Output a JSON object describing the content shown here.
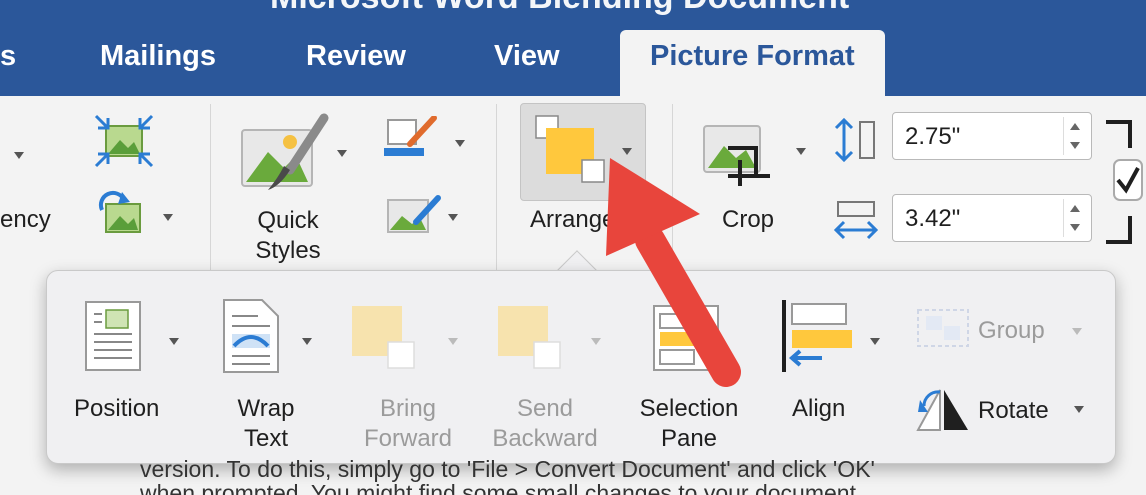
{
  "window": {
    "doc_title": "Microsoft Word Blending Document"
  },
  "tabs": [
    "s",
    "Mailings",
    "Review",
    "View",
    "Picture Format"
  ],
  "ribbon": {
    "transparency_label": "ency",
    "quick_styles_label": "Quick Styles",
    "arrange_label": "Arrange",
    "crop_label": "Crop",
    "height_value": "2.75\"",
    "width_value": "3.42\""
  },
  "arrange_panel": {
    "position": "Position",
    "wrap_text": "Wrap Text",
    "bring_forward": "Bring Forward",
    "send_backward": "Send Backward",
    "selection_pane": "Selection Pane",
    "align": "Align",
    "group": "Group",
    "rotate": "Rotate"
  },
  "document": {
    "line1": "version. To do this, simply go to 'File > Convert Document' and click 'OK'",
    "line2": "when prompted. You might find some small changes to your document."
  },
  "colors": {
    "title_bar": "#2b579a",
    "ribbon_bg": "#f3f3f3",
    "annotation_arrow": "#e8453c",
    "shape_yellow": "#ffc83d"
  }
}
